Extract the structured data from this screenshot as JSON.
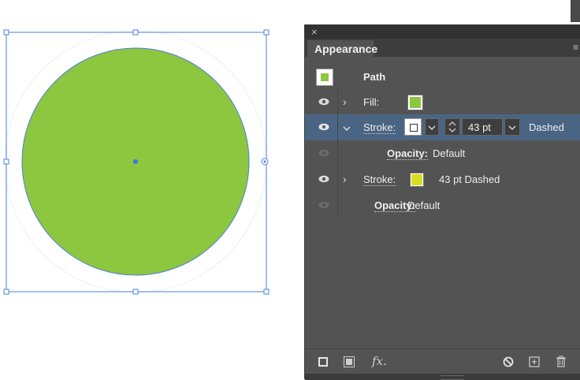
{
  "panel": {
    "close_glyph": "×",
    "tab_title": "Appearance",
    "menu_glyph": "≡",
    "header_label": "Path",
    "rows": {
      "fill_label": "Fill:",
      "stroke1_label": "Stroke:",
      "stroke1_weight": "43 pt",
      "stroke1_style": "Dashed",
      "opacity1_label": "Opacity:",
      "opacity1_value": "Default",
      "stroke2_label": "Stroke:",
      "stroke2_summary": "43 pt Dashed",
      "opacity2_label": "Opacity:",
      "opacity2_value": "Default"
    },
    "footer_fx": "fx."
  },
  "colors": {
    "fill": "#8dc63f",
    "stroke2": "#d7df23",
    "selection_row": "#4a6583",
    "bounding_box": "#4a7fe0"
  },
  "icons": [
    "close-icon",
    "menu-icon",
    "eye-icon",
    "chevron-right-icon",
    "chevron-down-icon",
    "stepper-icon",
    "new-stroke-icon",
    "new-fill-icon",
    "fx-icon",
    "clear-appearance-icon",
    "duplicate-item-icon",
    "trash-icon"
  ]
}
